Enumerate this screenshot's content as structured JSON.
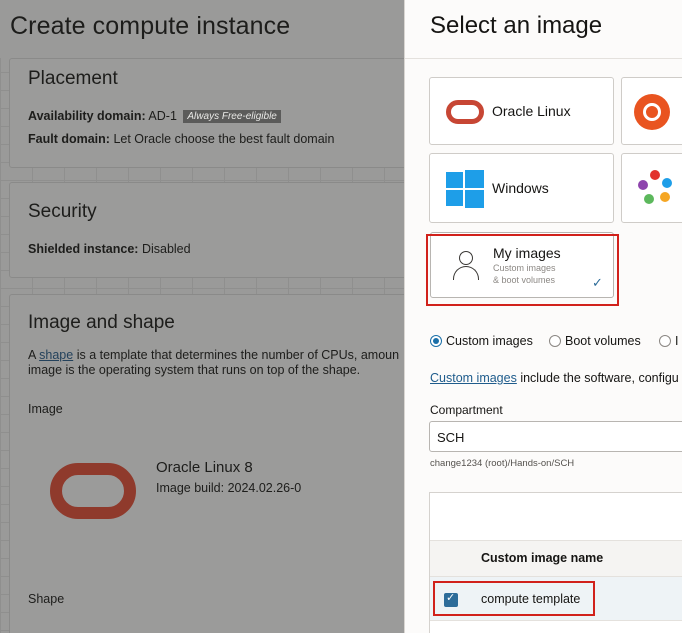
{
  "left_page": {
    "title": "Create compute instance",
    "placement": {
      "heading": "Placement",
      "availability_label": "Availability domain:",
      "availability_value": "AD-1",
      "availability_badge": "Always Free-eligible",
      "fault_label": "Fault domain:",
      "fault_value": "Let Oracle choose the best fault domain"
    },
    "security": {
      "heading": "Security",
      "shielded_label": "Shielded instance:",
      "shielded_value": "Disabled"
    },
    "image_shape": {
      "heading": "Image and shape",
      "desc_prefix": "A",
      "desc_link": "shape",
      "desc_line1": "is a template that determines the number of CPUs, amoun",
      "desc_line2": "image is the operating system that runs on top of the shape.",
      "image_label": "Image",
      "image_name": "Oracle Linux 8",
      "image_build": "Image build: 2024.02.26-0",
      "shape_label": "Shape"
    }
  },
  "panel": {
    "title": "Select an image",
    "tiles": {
      "oracle_linux": "Oracle Linux",
      "windows": "Windows",
      "my_images": "My images",
      "my_images_sub1": "Custom images",
      "my_images_sub2": "& boot volumes"
    },
    "radios": {
      "custom_images": "Custom images",
      "boot_volumes": "Boot volumes",
      "third": "I"
    },
    "desc_link": "Custom images",
    "desc_text": "include the software, configu",
    "compartment_label": "Compartment",
    "compartment_value": "SCH",
    "compartment_path": "change1234 (root)/Hands-on/SCH",
    "table": {
      "column_header": "Custom image name",
      "row_name": "compute template"
    }
  },
  "colors": {
    "oracle_red": "#c74634",
    "highlight_red": "#d1211b",
    "accent_blue": "#2d6c99"
  }
}
